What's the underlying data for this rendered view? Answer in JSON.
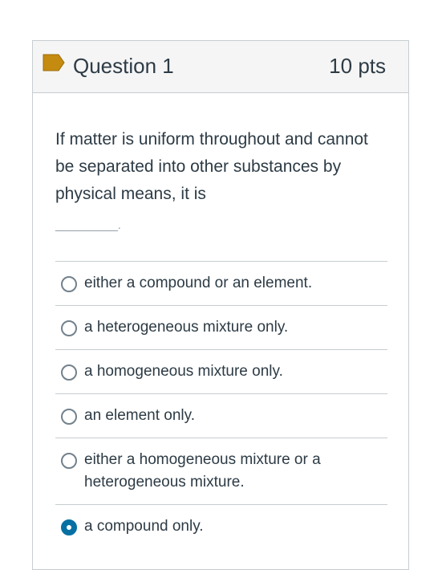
{
  "question": {
    "title": "Question 1",
    "points": "10 pts",
    "flag_icon": "bookmark-flag-icon",
    "flag_color": "#c58b10",
    "text": "If matter is uniform throughout and cannot be separated into other substances by physical means, it is",
    "blank": "__________."
  },
  "answers": [
    {
      "label": "either a compound or an element.",
      "selected": false
    },
    {
      "label": "a heterogeneous mixture only.",
      "selected": false
    },
    {
      "label": "a homogeneous mixture only.",
      "selected": false
    },
    {
      "label": "an element only.",
      "selected": false
    },
    {
      "label": "either a homogeneous mixture or a heterogeneous mixture.",
      "selected": false
    },
    {
      "label": "a compound only.",
      "selected": true
    }
  ],
  "colors": {
    "accent": "#0770a3",
    "border": "#c7cdd1",
    "header_bg": "#f5f5f5"
  }
}
